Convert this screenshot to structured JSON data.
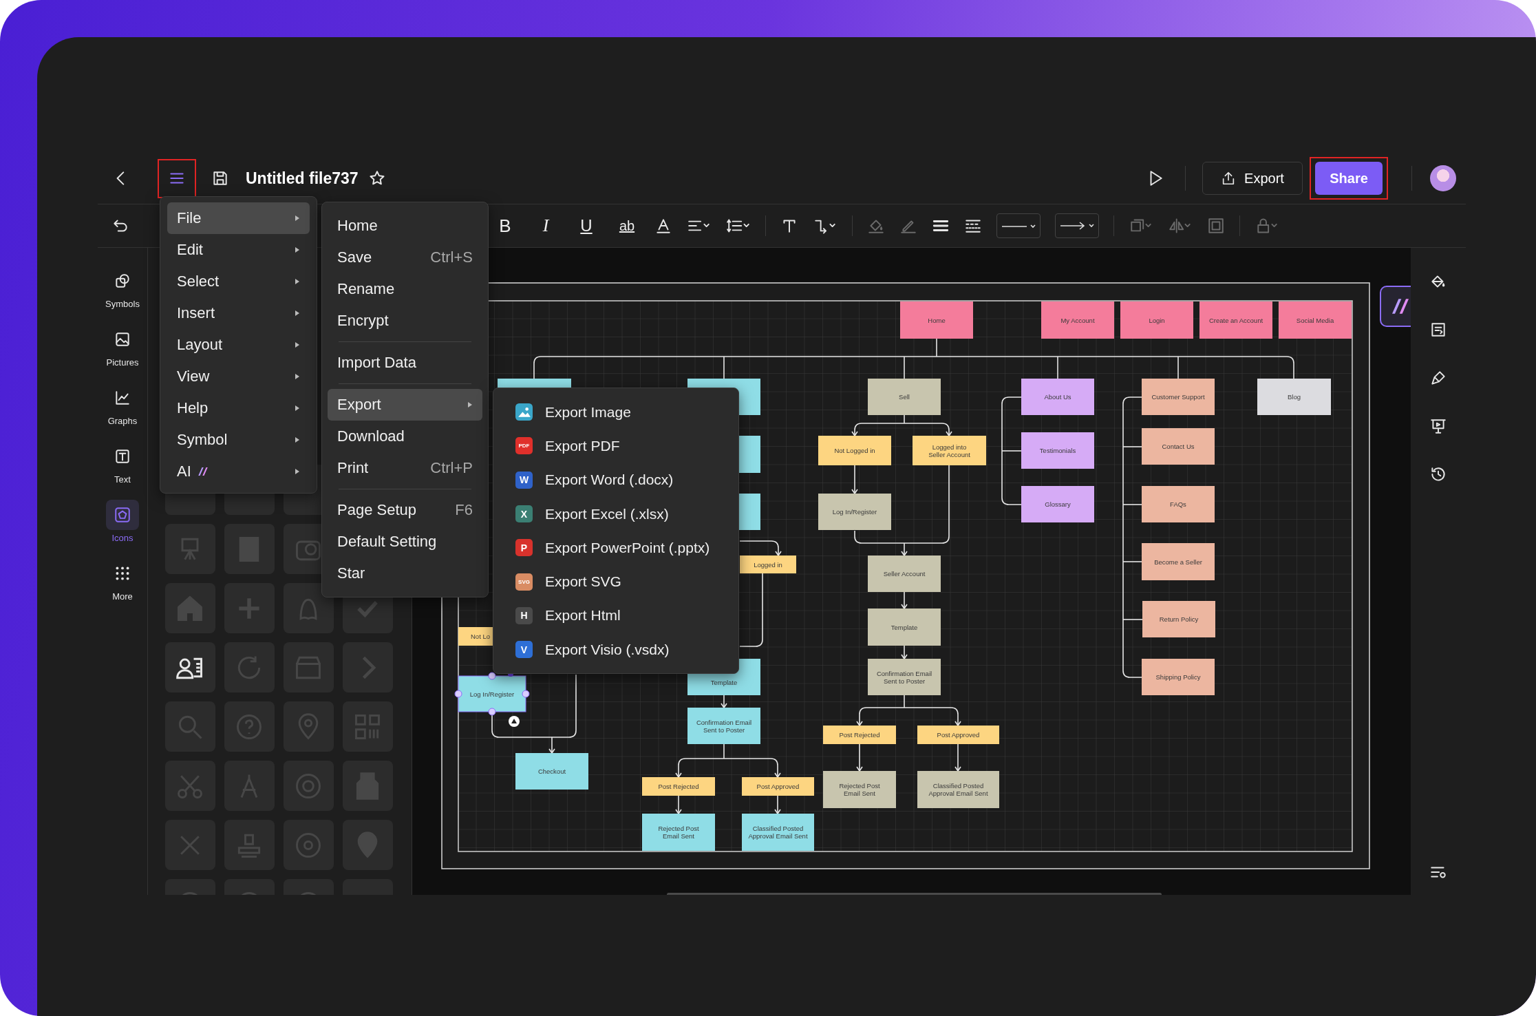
{
  "top_bar": {
    "title": "Untitled file737",
    "export_label": "Export",
    "share_label": "Share"
  },
  "toolbar": {
    "format_buttons": [
      "B",
      "I",
      "U",
      "ab"
    ]
  },
  "sidebar": {
    "items": [
      {
        "label": "Symbols",
        "kind": "symbols",
        "selected": false
      },
      {
        "label": "Pictures",
        "kind": "pictures",
        "selected": false
      },
      {
        "label": "Graphs",
        "kind": "graphs",
        "selected": false
      },
      {
        "label": "Text",
        "kind": "text",
        "selected": false
      },
      {
        "label": "Icons",
        "kind": "icons",
        "selected": true
      },
      {
        "label": "More",
        "kind": "more",
        "selected": false
      }
    ]
  },
  "main_menu": {
    "items": [
      {
        "label": "File",
        "kind": "plain",
        "selected": true
      },
      {
        "label": "Edit",
        "kind": "plain",
        "selected": false
      },
      {
        "label": "Select",
        "kind": "plain",
        "selected": false
      },
      {
        "label": "Insert",
        "kind": "plain",
        "selected": false
      },
      {
        "label": "Layout",
        "kind": "plain",
        "selected": false
      },
      {
        "label": "View",
        "kind": "plain",
        "selected": false
      },
      {
        "label": "Help",
        "kind": "plain",
        "selected": false
      },
      {
        "label": "Symbol",
        "kind": "plain",
        "selected": false
      },
      {
        "label": "AI",
        "kind": "ai",
        "selected": false
      }
    ]
  },
  "file_menu": {
    "groups": [
      [
        {
          "label": "Home",
          "selected": false
        },
        {
          "label": "Save",
          "shortcut": "Ctrl+S",
          "selected": false
        },
        {
          "label": "Rename",
          "selected": false
        },
        {
          "label": "Encrypt",
          "selected": false
        }
      ],
      [
        {
          "label": "Import Data",
          "selected": false
        }
      ],
      [
        {
          "label": "Export",
          "submenu": true,
          "selected": true
        },
        {
          "label": "Download",
          "selected": false
        },
        {
          "label": "Print",
          "shortcut": "Ctrl+P",
          "selected": false
        }
      ],
      [
        {
          "label": "Page Setup",
          "shortcut": "F6",
          "selected": false
        },
        {
          "label": "Default Setting",
          "selected": false
        },
        {
          "label": "Star",
          "selected": false
        }
      ]
    ]
  },
  "export_menu": {
    "items": [
      {
        "label": "Export Image",
        "kind": "image",
        "color": "#3aa6c9"
      },
      {
        "label": "Export PDF",
        "kind": "letter",
        "badge": "PDF",
        "color": "#e0302b"
      },
      {
        "label": "Export Word (.docx)",
        "kind": "letter",
        "badge": "W",
        "color": "#2f62c9"
      },
      {
        "label": "Export Excel (.xlsx)",
        "kind": "letter",
        "badge": "X",
        "color": "#3b7f73"
      },
      {
        "label": "Export PowerPoint (.pptx)",
        "kind": "letter",
        "badge": "P",
        "color": "#d8322c"
      },
      {
        "label": "Export SVG",
        "kind": "letter",
        "badge": "SVG",
        "color": "#d98c63"
      },
      {
        "label": "Export Html",
        "kind": "letter",
        "badge": "H",
        "color": "#4a4a4a"
      },
      {
        "label": "Export Visio (.vsdx)",
        "kind": "letter",
        "badge": "V",
        "color": "#2e6fd6"
      }
    ]
  },
  "diagram": {
    "nodes": [
      {
        "lines": [
          "Home"
        ],
        "color": "#f47c9b",
        "selected": false
      },
      {
        "lines": [
          "My Account"
        ],
        "color": "#f47c9b",
        "selected": false
      },
      {
        "lines": [
          "Login"
        ],
        "color": "#f47c9b",
        "selected": false
      },
      {
        "lines": [
          "Create an Account"
        ],
        "color": "#f47c9b",
        "selected": false
      },
      {
        "lines": [
          "Social Media"
        ],
        "color": "#f47c9b",
        "selected": false
      },
      {
        "color": "#8fdde6",
        "selected": false
      },
      {
        "color": "#8fdde6",
        "selected": false
      },
      {
        "lines": [
          "Sell"
        ],
        "color": "#c8c5ae",
        "selected": false
      },
      {
        "lines": [
          "About Us"
        ],
        "color": "#d6abf6",
        "selected": false
      },
      {
        "lines": [
          "Customer Support"
        ],
        "color": "#ecb6a0",
        "selected": false
      },
      {
        "lines": [
          "Blog"
        ],
        "color": "#dcdce0",
        "selected": false
      },
      {
        "color": "#8fdde6",
        "selected": false
      },
      {
        "lines": [
          "Not Logged in"
        ],
        "color": "#fdd581",
        "selected": false
      },
      {
        "lines": [
          "Logged into",
          "Seller Account"
        ],
        "color": "#fdd581",
        "selected": false
      },
      {
        "lines": [
          "Testimonials"
        ],
        "color": "#d6abf6",
        "selected": false
      },
      {
        "lines": [
          "Contact Us"
        ],
        "color": "#ecb6a0",
        "selected": false
      },
      {
        "color": "#8fdde6",
        "selected": false
      },
      {
        "lines": [
          "Log In/Register"
        ],
        "color": "#c8c5ae",
        "selected": false
      },
      {
        "lines": [
          "Glossary"
        ],
        "color": "#d6abf6",
        "selected": false
      },
      {
        "lines": [
          "FAQs"
        ],
        "color": "#ecb6a0",
        "selected": false
      },
      {
        "lines": [
          "Logged in"
        ],
        "color": "#fdd581",
        "selected": false
      },
      {
        "lines": [
          "Seller Account"
        ],
        "color": "#c8c5ae",
        "selected": false
      },
      {
        "lines": [
          "Become a Seller"
        ],
        "color": "#ecb6a0",
        "selected": false
      },
      {
        "lines": [
          "Template"
        ],
        "color": "#c8c5ae",
        "selected": false
      },
      {
        "lines": [
          "Return Policy"
        ],
        "color": "#ecb6a0",
        "selected": false
      },
      {
        "lines": [
          "Not Lo"
        ],
        "color": "#fdd581",
        "selected": false
      },
      {
        "lines": [
          "Template"
        ],
        "color": "#8fdde6",
        "selected": false
      },
      {
        "lines": [
          "Confirmation Email",
          "Sent to Poster"
        ],
        "color": "#c8c5ae",
        "selected": false
      },
      {
        "lines": [
          "Shipping Policy"
        ],
        "color": "#ecb6a0",
        "selected": false
      },
      {
        "lines": [
          "Log In/Register"
        ],
        "color": "#8fdde6",
        "selected": true
      },
      {
        "lines": [
          "Confirmation Email",
          "Sent to Poster"
        ],
        "color": "#8fdde6",
        "selected": false
      },
      {
        "lines": [
          "Post Rejected"
        ],
        "color": "#fdd581",
        "selected": false
      },
      {
        "lines": [
          "Post Approved"
        ],
        "color": "#fdd581",
        "selected": false
      },
      {
        "lines": [
          "Checkout"
        ],
        "color": "#8fdde6",
        "selected": false
      },
      {
        "lines": [
          "Post Rejected"
        ],
        "color": "#fdd581",
        "selected": false
      },
      {
        "lines": [
          "Post Approved"
        ],
        "color": "#fdd581",
        "selected": false
      },
      {
        "lines": [
          "Rejected Post",
          "Email Sent"
        ],
        "color": "#c8c5ae",
        "selected": false
      },
      {
        "lines": [
          "Classified Posted",
          "Approval Email Sent"
        ],
        "color": "#c8c5ae",
        "selected": false
      },
      {
        "lines": [
          "Rejected Post",
          "Email Sent"
        ],
        "color": "#8fdde6",
        "selected": false
      },
      {
        "lines": [
          "Classified Posted",
          "Approval Email Sent"
        ],
        "color": "#8fdde6",
        "selected": false
      }
    ]
  }
}
